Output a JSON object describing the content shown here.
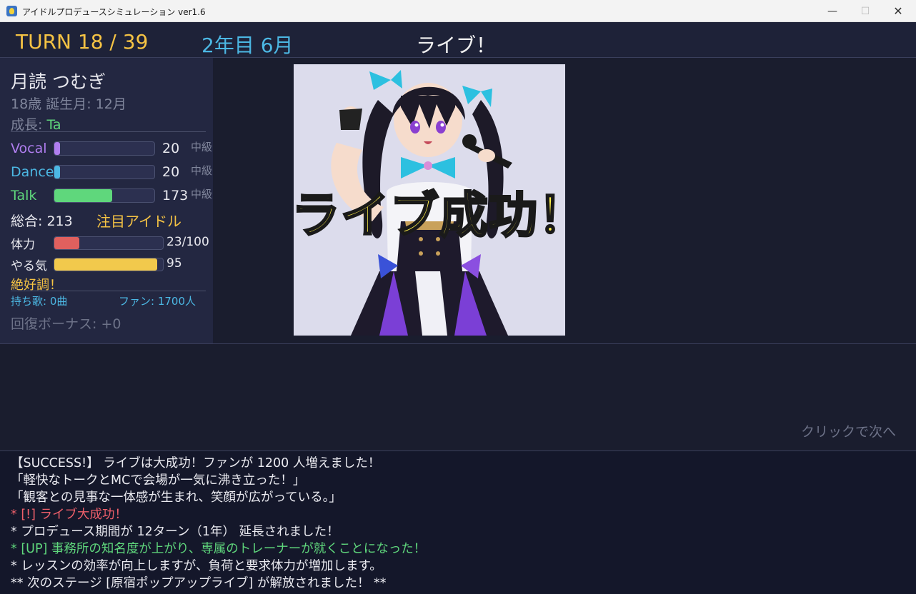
{
  "window": {
    "title": "アイドルプロデュースシミュレーション ver1.6",
    "minimize": "—",
    "maximize": "☐",
    "close": "✕"
  },
  "header": {
    "turn": "TURN 18 / 39",
    "date": "2年目 6月",
    "event": "ライブ！"
  },
  "idol": {
    "name": "月読 つむぎ",
    "age_birth": "18歳  誕生月: 12月",
    "growth_label": "成長: ",
    "growth_value": "Ta"
  },
  "stats": [
    {
      "label": "Vocal",
      "value": "20",
      "level": 0.06,
      "rank": "中級",
      "color": "#b07ef0"
    },
    {
      "label": "Dance",
      "value": "20",
      "level": 0.06,
      "rank": "中級",
      "color": "#4cb8e4"
    },
    {
      "label": "Talk",
      "value": "173",
      "level": 0.58,
      "rank": "中級",
      "color": "#5fd77c"
    }
  ],
  "total": "総合: 213",
  "rank_title": "注目アイドル",
  "stamina": {
    "label": "体力",
    "value": "23/100",
    "level": 0.23,
    "color": "#e0605e"
  },
  "motivation": {
    "label": "やる気",
    "value": "95",
    "level": 0.95,
    "color": "#f2c94c"
  },
  "condition": "絶好調！",
  "songs": "持ち歌: 0曲",
  "fans": "ファン: 1700人",
  "recovery_bonus": "回復ボーナス: +0",
  "overlay": "ライブ成功！",
  "next_hint": "クリックで次へ",
  "log": [
    {
      "text": "【SUCCESS!】 ライブは大成功！ファンが 1200 人増えました！",
      "color": "white"
    },
    {
      "text": "「軽快なトークとMCで会場が一気に沸き立った！」",
      "color": "white"
    },
    {
      "text": "「観客との見事な一体感が生まれ、笑顔が広がっている。」",
      "color": "white"
    },
    {
      "text": "* [!] ライブ大成功！",
      "color": "red"
    },
    {
      "text": "* プロデュース期間が 12ターン（1年） 延長されました！",
      "color": "white"
    },
    {
      "text": "* [UP] 事務所の知名度が上がり、専属のトレーナーが就くことになった！",
      "color": "green"
    },
    {
      "text": "* レッスンの効率が向上しますが、負荷と要求体力が増加します。",
      "color": "white"
    },
    {
      "text": "** 次のステージ [原宿ポップアップライブ] が解放されました！ **",
      "color": "white"
    }
  ]
}
